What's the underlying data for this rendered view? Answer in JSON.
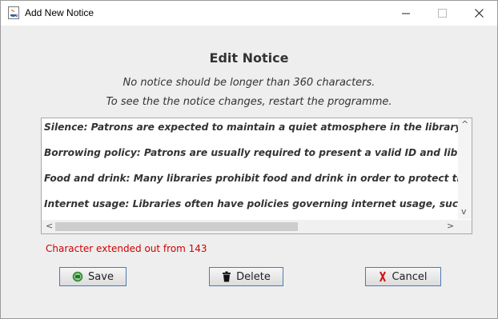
{
  "window": {
    "title": "Add New Notice",
    "controls": [
      "minimize-icon",
      "maximize-icon",
      "close-icon"
    ]
  },
  "content": {
    "heading": "Edit Notice",
    "note1": "No notice should be longer than 360 characters.",
    "note2": "To see the the notice changes, restart the programme.",
    "notice_lines": [
      "Silence: Patrons are expected to maintain a quiet atmosphere in the library to allow",
      "Borrowing policy: Patrons are usually required to present a valid ID and library card",
      "Food and drink: Many libraries prohibit food and drink in order to protect the mater",
      "Internet usage: Libraries often have policies governing internet usage, such as restri"
    ],
    "error": "Character extended out from 143"
  },
  "buttons": {
    "save": "Save",
    "delete": "Delete",
    "cancel": "Cancel"
  },
  "colors": {
    "error": "#d00000",
    "button_border": "#4d7ab3"
  }
}
